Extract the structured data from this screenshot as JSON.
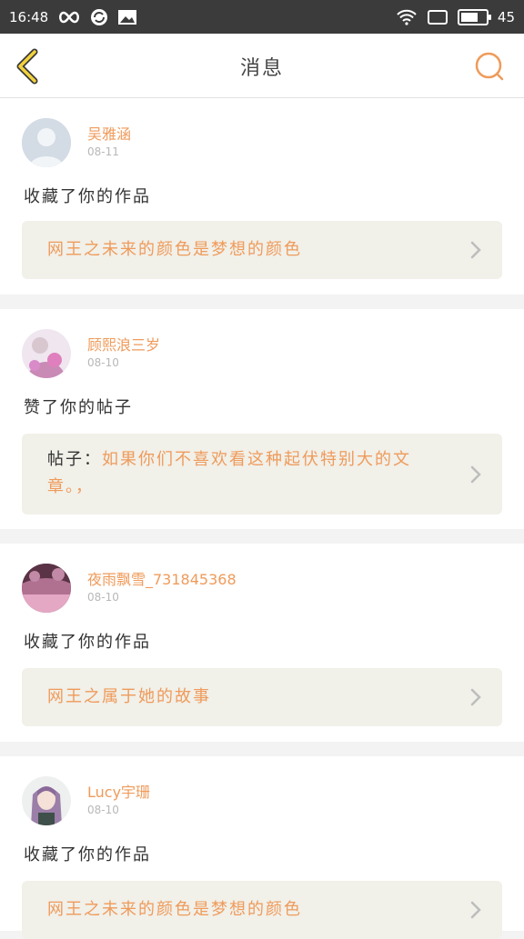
{
  "status_bar": {
    "time": "16:48",
    "battery": "45"
  },
  "header": {
    "title": "消息"
  },
  "colors": {
    "accent": "#ef9b5b",
    "back_arrow": "#f3d23c",
    "ref_bg": "#f1f0e9"
  },
  "messages": [
    {
      "username": "吴雅涵",
      "date": "08-11",
      "action": "收藏了你的作品",
      "ref_prefix": "",
      "ref_text": "网王之未来的颜色是梦想的颜色"
    },
    {
      "username": "顾熙浪三岁",
      "date": "08-10",
      "action": "赞了你的帖子",
      "ref_prefix": "帖子：",
      "ref_text": "如果你们不喜欢看这种起伏特别大的文章。，"
    },
    {
      "username": "夜雨飘雪_731845368",
      "date": "08-10",
      "action": "收藏了你的作品",
      "ref_prefix": "",
      "ref_text": "网王之属于她的故事"
    },
    {
      "username": "Lucy宇珊",
      "date": "08-10",
      "action": "收藏了你的作品",
      "ref_prefix": "",
      "ref_text": "网王之未来的颜色是梦想的颜色"
    }
  ]
}
